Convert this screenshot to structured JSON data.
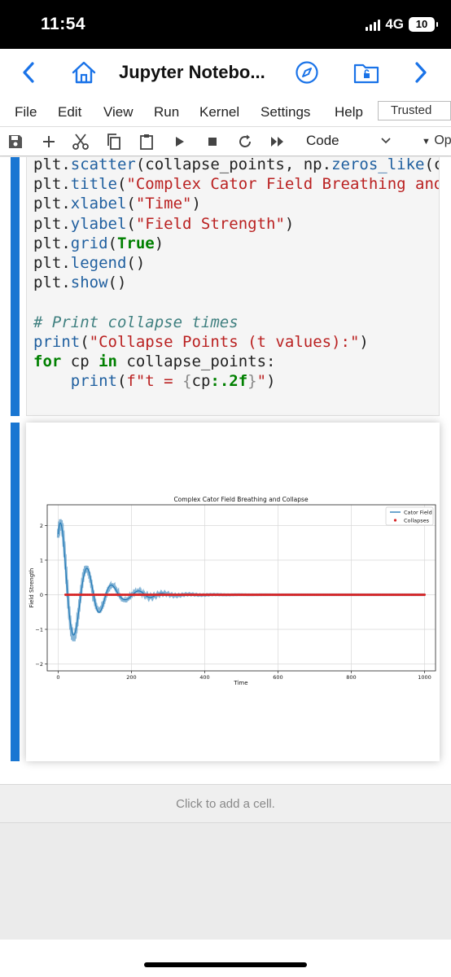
{
  "status": {
    "time": "11:54",
    "network": "4G",
    "battery": "10"
  },
  "browser": {
    "title": "Jupyter Notebo..."
  },
  "menu": {
    "items": [
      "File",
      "Edit",
      "View",
      "Run",
      "Kernel",
      "Settings",
      "Help"
    ],
    "trusted": "Trusted"
  },
  "toolbar": {
    "cell_type": "Code",
    "more_label": "Op"
  },
  "code_lines": [
    "plt.scatter(collapse_points, np.zeros_like(colla",
    "plt.title(\"Complex Cator Field Breathing and Col",
    "plt.xlabel(\"Time\")",
    "plt.ylabel(\"Field Strength\")",
    "plt.grid(True)",
    "plt.legend()",
    "plt.show()",
    "",
    "# Print collapse times",
    "print(\"Collapse Points (t values):\")",
    "for cp in collapse_points:",
    "    print(f\"t = {cp:.2f}\")"
  ],
  "chart_data": {
    "type": "line",
    "title": "Complex Cator Field Breathing and Collapse",
    "xlabel": "Time",
    "ylabel": "Field Strength",
    "xlim": [
      -30,
      1030
    ],
    "ylim": [
      -2.2,
      2.6
    ],
    "xticks": [
      "0",
      "200",
      "400",
      "600",
      "800",
      "1000"
    ],
    "yticks": [
      "2",
      "1",
      "0",
      "−1",
      "−2"
    ],
    "grid": true,
    "legend_position": "top-right",
    "series": [
      {
        "name": "Cator Field",
        "kind": "line",
        "color": "#1f77b4",
        "description_amplitude": [
          2.4,
          1.0,
          0.5,
          0.2,
          0.05
        ],
        "peak_x": [
          10,
          80,
          150,
          230,
          330
        ]
      },
      {
        "name": "Collapses",
        "kind": "scatter",
        "color": "#d62728",
        "x_start": 20,
        "x_end": 1000,
        "y": 0
      }
    ]
  },
  "footer": {
    "add_cell": "Click to add a cell."
  }
}
